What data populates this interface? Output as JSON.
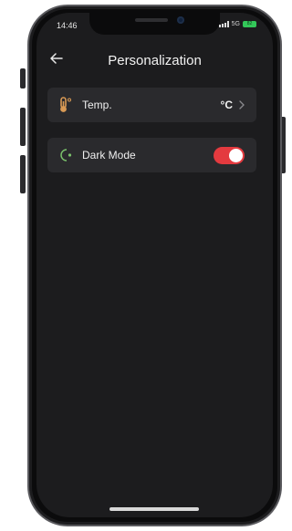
{
  "status_bar": {
    "time": "14:46",
    "network": "5G",
    "battery": "82"
  },
  "header": {
    "title": "Personalization"
  },
  "settings": {
    "temp": {
      "label": "Temp.",
      "value": "°C"
    },
    "dark_mode": {
      "label": "Dark Mode",
      "enabled": true
    }
  },
  "colors": {
    "background": "#1c1c1e",
    "card": "#2a2a2d",
    "toggle_on": "#e43a3f",
    "icon_temp": "#d99a55",
    "icon_dark": "#79c06a"
  },
  "icons": {
    "back": "arrow-left-icon",
    "temp": "thermometer-icon",
    "dark_mode": "moon-icon",
    "chevron": "chevron-right-icon"
  }
}
